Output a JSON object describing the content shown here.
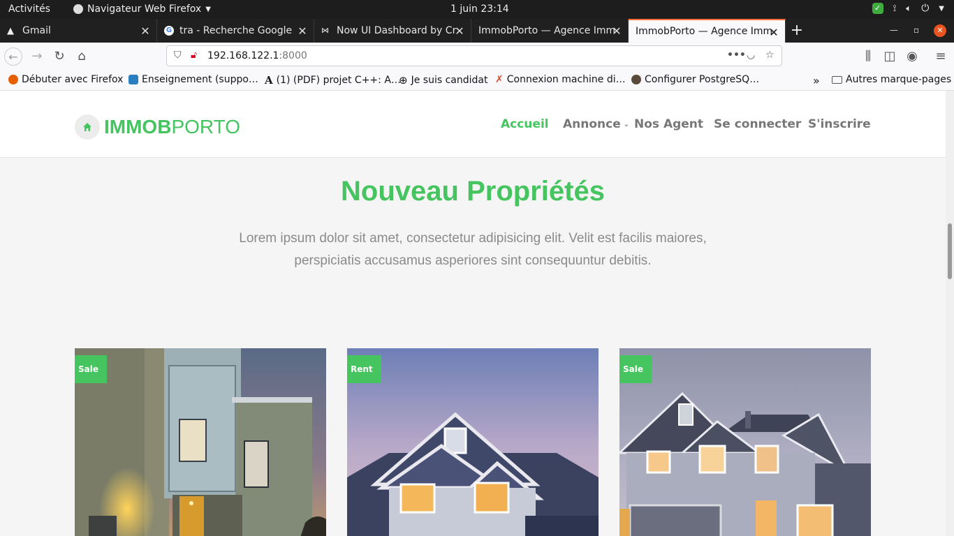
{
  "system_bar": {
    "activities": "Activités",
    "app_name": "Navigateur Web Firefox",
    "clock": "1 juin  23:14"
  },
  "tabs": [
    {
      "label": "Gmail",
      "icon": "gmail-warning-icon"
    },
    {
      "label": "tra - Recherche Google",
      "icon": "google-icon"
    },
    {
      "label": "Now UI Dashboard by Cr",
      "icon": "creative-tim-icon"
    },
    {
      "label": "ImmobPorto — Agence Imm",
      "icon": "page-icon"
    },
    {
      "label": "ImmobPorto — Agence Imm",
      "icon": "page-icon",
      "active": true
    }
  ],
  "url": {
    "host": "192.168.122.1",
    "port": ":8000"
  },
  "bookmarks": [
    {
      "label": "Débuter avec Firefox",
      "icon": "firefox-icon",
      "color": "#e66000"
    },
    {
      "label": "Enseignement (suppo…",
      "icon": "book-icon",
      "color": "#2a7fc1"
    },
    {
      "label": "(1) (PDF) projet C++: A…",
      "icon": "academia-icon",
      "color": "#222222"
    },
    {
      "label": "Je suis candidat",
      "icon": "globe-icon",
      "color": "#333333"
    },
    {
      "label": "Connexion machine di…",
      "icon": "tools-icon",
      "color": "#d94a2b"
    },
    {
      "label": "Configurer PostgreSQ…",
      "icon": "postgres-icon",
      "color": "#5a4a3a"
    }
  ],
  "other_bookmarks": "Autres marque-pages",
  "site": {
    "logo_bold": "IMMOB",
    "logo_light": "PORTO",
    "nav": [
      {
        "label": "Accueil",
        "active": true
      },
      {
        "label": "Annonce",
        "dropdown": true
      },
      {
        "label": "Nos Agent"
      },
      {
        "label": "Se connecter"
      },
      {
        "label": "S'inscrire"
      }
    ],
    "section_title": "Nouveau Propriétés",
    "section_lead": "Lorem ipsum dolor sit amet, consectetur adipisicing elit. Velit est facilis maiores, perspiciatis accusamus asperiores sint consequuntur debitis.",
    "cards": [
      {
        "badge": "Sale"
      },
      {
        "badge": "Rent"
      },
      {
        "badge": "Sale"
      }
    ]
  },
  "colors": {
    "brand_green": "#45c45f",
    "firefox_accent": "#ff7139"
  }
}
